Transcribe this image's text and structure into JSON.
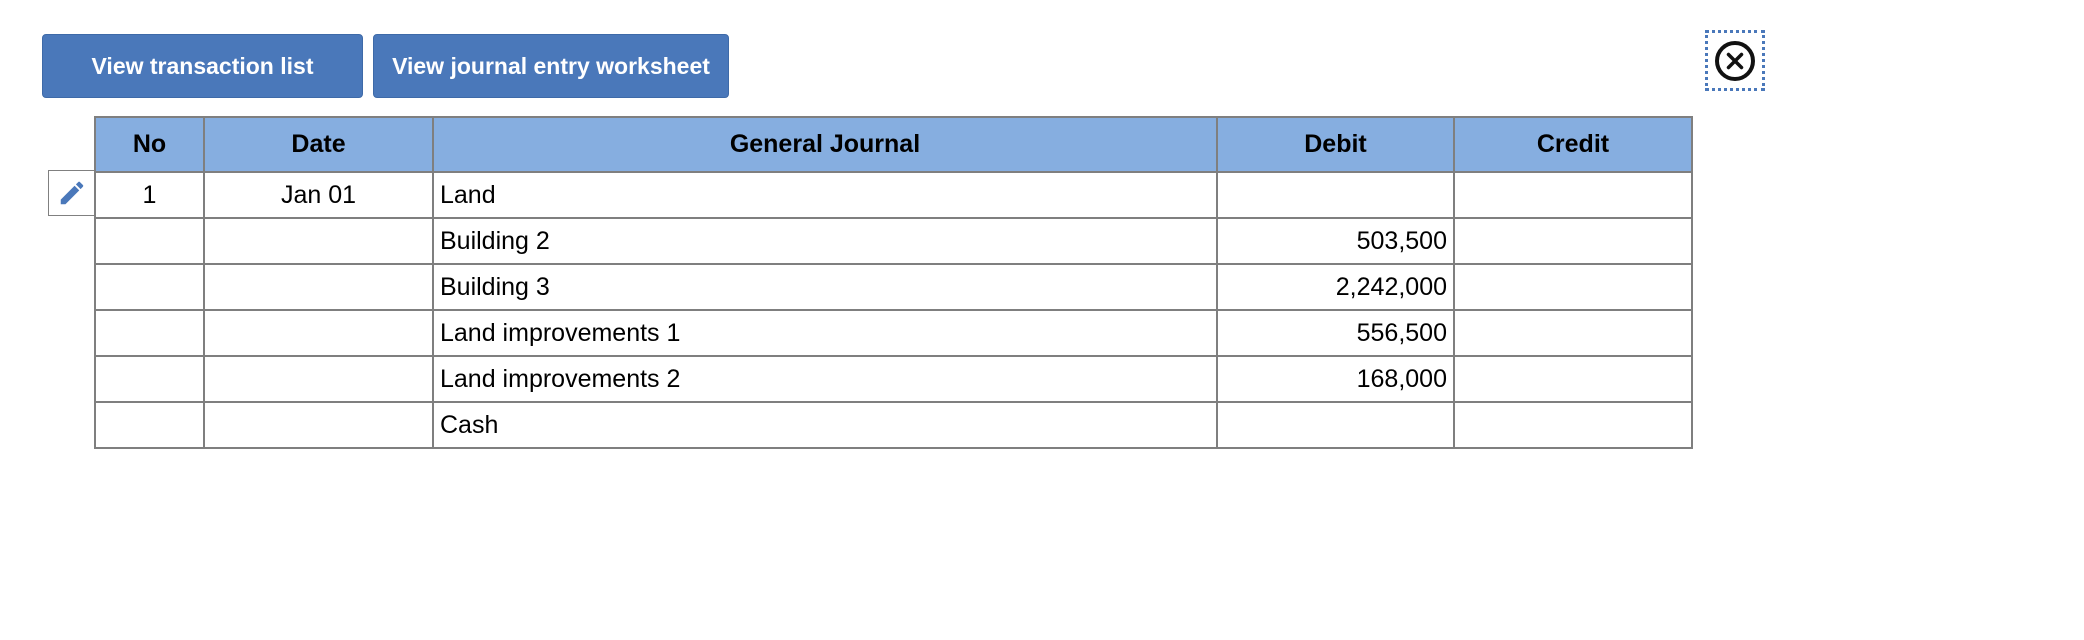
{
  "toolbar": {
    "transaction_list_label": "View transaction list",
    "journal_worksheet_label": "View journal entry worksheet"
  },
  "icons": {
    "close": "close-circle-icon",
    "edit": "pencil-icon"
  },
  "colors": {
    "button": "#4a78ba",
    "header": "#86aee0",
    "grid": "#7f7f7f"
  },
  "journal": {
    "headers": {
      "no": "No",
      "date": "Date",
      "account": "General Journal",
      "debit": "Debit",
      "credit": "Credit"
    },
    "rows": [
      {
        "no": "1",
        "date": "Jan 01",
        "account": "Land",
        "debit": "",
        "credit": ""
      },
      {
        "no": "",
        "date": "",
        "account": "Building 2",
        "debit": "503,500",
        "credit": ""
      },
      {
        "no": "",
        "date": "",
        "account": "Building 3",
        "debit": "2,242,000",
        "credit": ""
      },
      {
        "no": "",
        "date": "",
        "account": "Land improvements 1",
        "debit": "556,500",
        "credit": ""
      },
      {
        "no": "",
        "date": "",
        "account": "Land improvements 2",
        "debit": "168,000",
        "credit": ""
      },
      {
        "no": "",
        "date": "",
        "account": "Cash",
        "debit": "",
        "credit": ""
      }
    ]
  }
}
